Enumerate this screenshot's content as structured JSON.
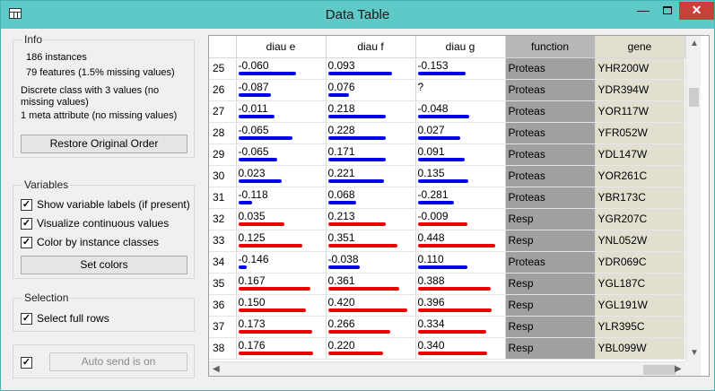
{
  "window": {
    "title": "Data Table",
    "minimize": "—",
    "close": "✕"
  },
  "info": {
    "title": "Info",
    "lines": [
      "186 instances",
      "79 features (1.5% missing values)",
      "Discrete class with 3 values (no missing values)",
      "1 meta attribute (no missing values)"
    ],
    "restore_button": "Restore Original Order"
  },
  "variables": {
    "title": "Variables",
    "show_labels": {
      "label": "Show variable labels (if present)",
      "checked": true
    },
    "visualize": {
      "label": "Visualize continuous values",
      "checked": true
    },
    "color_by_class": {
      "label": "Color by instance classes",
      "checked": true
    },
    "set_colors_button": "Set colors"
  },
  "selection": {
    "title": "Selection",
    "select_full_rows": {
      "label": "Select full rows",
      "checked": true
    }
  },
  "auto_send": {
    "checked": true,
    "button": "Auto send is on"
  },
  "colors": {
    "proteas": "#0000ee",
    "resp": "#ee0000",
    "function_bg": "#a0a0a0",
    "gene_bg": "#e1e0d0"
  },
  "table": {
    "headers": [
      "",
      "diau e",
      "diau f",
      "diau g",
      "function",
      "gene"
    ],
    "rows": [
      {
        "n": "25",
        "e": "-0.060",
        "f": "0.093",
        "g": "-0.153",
        "func": "Proteas",
        "gene": "YHR200W",
        "be": 0.68,
        "bf": 0.76,
        "bg": 0.56
      },
      {
        "n": "26",
        "e": "-0.087",
        "f": "0.076",
        "g": "?",
        "func": "Proteas",
        "gene": "YDR394W",
        "be": 0.38,
        "bf": 0.24,
        "bg": 0
      },
      {
        "n": "27",
        "e": "-0.011",
        "f": "0.218",
        "g": "-0.048",
        "func": "Proteas",
        "gene": "YOR117W",
        "be": 0.43,
        "bf": 0.68,
        "bg": 0.61
      },
      {
        "n": "28",
        "e": "-0.065",
        "f": "0.228",
        "g": "0.027",
        "func": "Proteas",
        "gene": "YFR052W",
        "be": 0.64,
        "bf": 0.68,
        "bg": 0.5
      },
      {
        "n": "29",
        "e": "-0.065",
        "f": "0.171",
        "g": "0.091",
        "func": "Proteas",
        "gene": "YDL147W",
        "be": 0.46,
        "bf": 0.68,
        "bg": 0.55
      },
      {
        "n": "30",
        "e": "0.023",
        "f": "0.221",
        "g": "0.135",
        "func": "Proteas",
        "gene": "YOR261C",
        "be": 0.51,
        "bf": 0.66,
        "bg": 0.6
      },
      {
        "n": "31",
        "e": "-0.118",
        "f": "0.068",
        "g": "-0.281",
        "func": "Proteas",
        "gene": "YBR173C",
        "be": 0.16,
        "bf": 0.33,
        "bg": 0.43
      },
      {
        "n": "32",
        "e": "0.035",
        "f": "0.213",
        "g": "-0.009",
        "func": "Resp",
        "gene": "YGR207C",
        "be": 0.54,
        "bf": 0.68,
        "bg": 0.58
      },
      {
        "n": "33",
        "e": "0.125",
        "f": "0.351",
        "g": "0.448",
        "func": "Resp",
        "gene": "YNL052W",
        "be": 0.76,
        "bf": 0.82,
        "bg": 0.92
      },
      {
        "n": "34",
        "e": "-0.146",
        "f": "-0.038",
        "g": "0.110",
        "func": "Proteas",
        "gene": "YDR069C",
        "be": 0.1,
        "bf": 0.37,
        "bg": 0.59
      },
      {
        "n": "35",
        "e": "0.167",
        "f": "0.361",
        "g": "0.388",
        "func": "Resp",
        "gene": "YGL187C",
        "be": 0.85,
        "bf": 0.84,
        "bg": 0.86
      },
      {
        "n": "36",
        "e": "0.150",
        "f": "0.420",
        "g": "0.396",
        "func": "Resp",
        "gene": "YGL191W",
        "be": 0.8,
        "bf": 0.94,
        "bg": 0.87
      },
      {
        "n": "37",
        "e": "0.173",
        "f": "0.266",
        "g": "0.334",
        "func": "Resp",
        "gene": "YLR395C",
        "be": 0.87,
        "bf": 0.73,
        "bg": 0.81
      },
      {
        "n": "38",
        "e": "0.176",
        "f": "0.220",
        "g": "0.340",
        "func": "Resp",
        "gene": "YBL099W",
        "be": 0.88,
        "bf": 0.65,
        "bg": 0.82
      }
    ]
  }
}
